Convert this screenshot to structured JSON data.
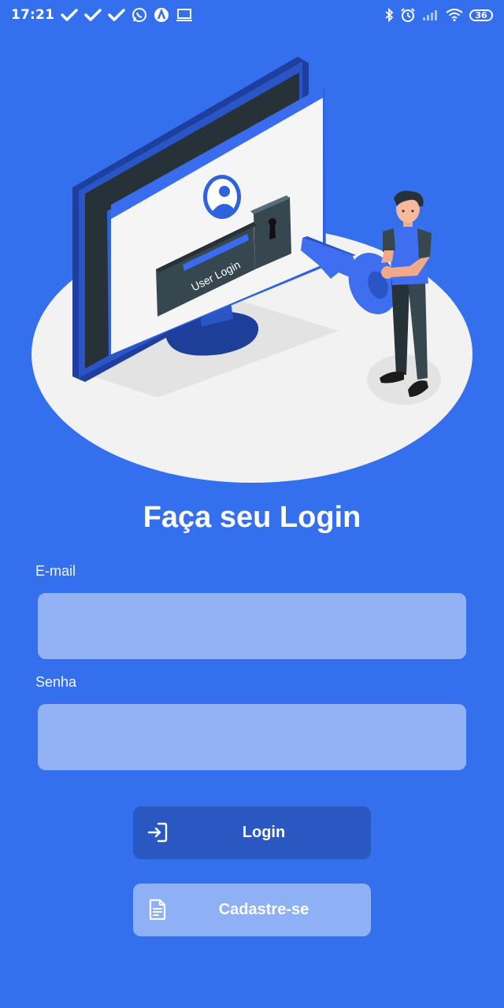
{
  "status_bar": {
    "time": "17:21",
    "battery": "36"
  },
  "illustration": {
    "screen_label": "User Login"
  },
  "login_form": {
    "title": "Faça seu Login",
    "email_label": "E-mail",
    "email_value": "",
    "password_label": "Senha",
    "password_value": "",
    "login_button": "Login",
    "register_button": "Cadastre-se"
  },
  "colors": {
    "background": "#3470ee",
    "input_bg": "#92b2f5",
    "login_button_bg": "#2a58c3",
    "register_button_bg": "#8eb0f5"
  }
}
